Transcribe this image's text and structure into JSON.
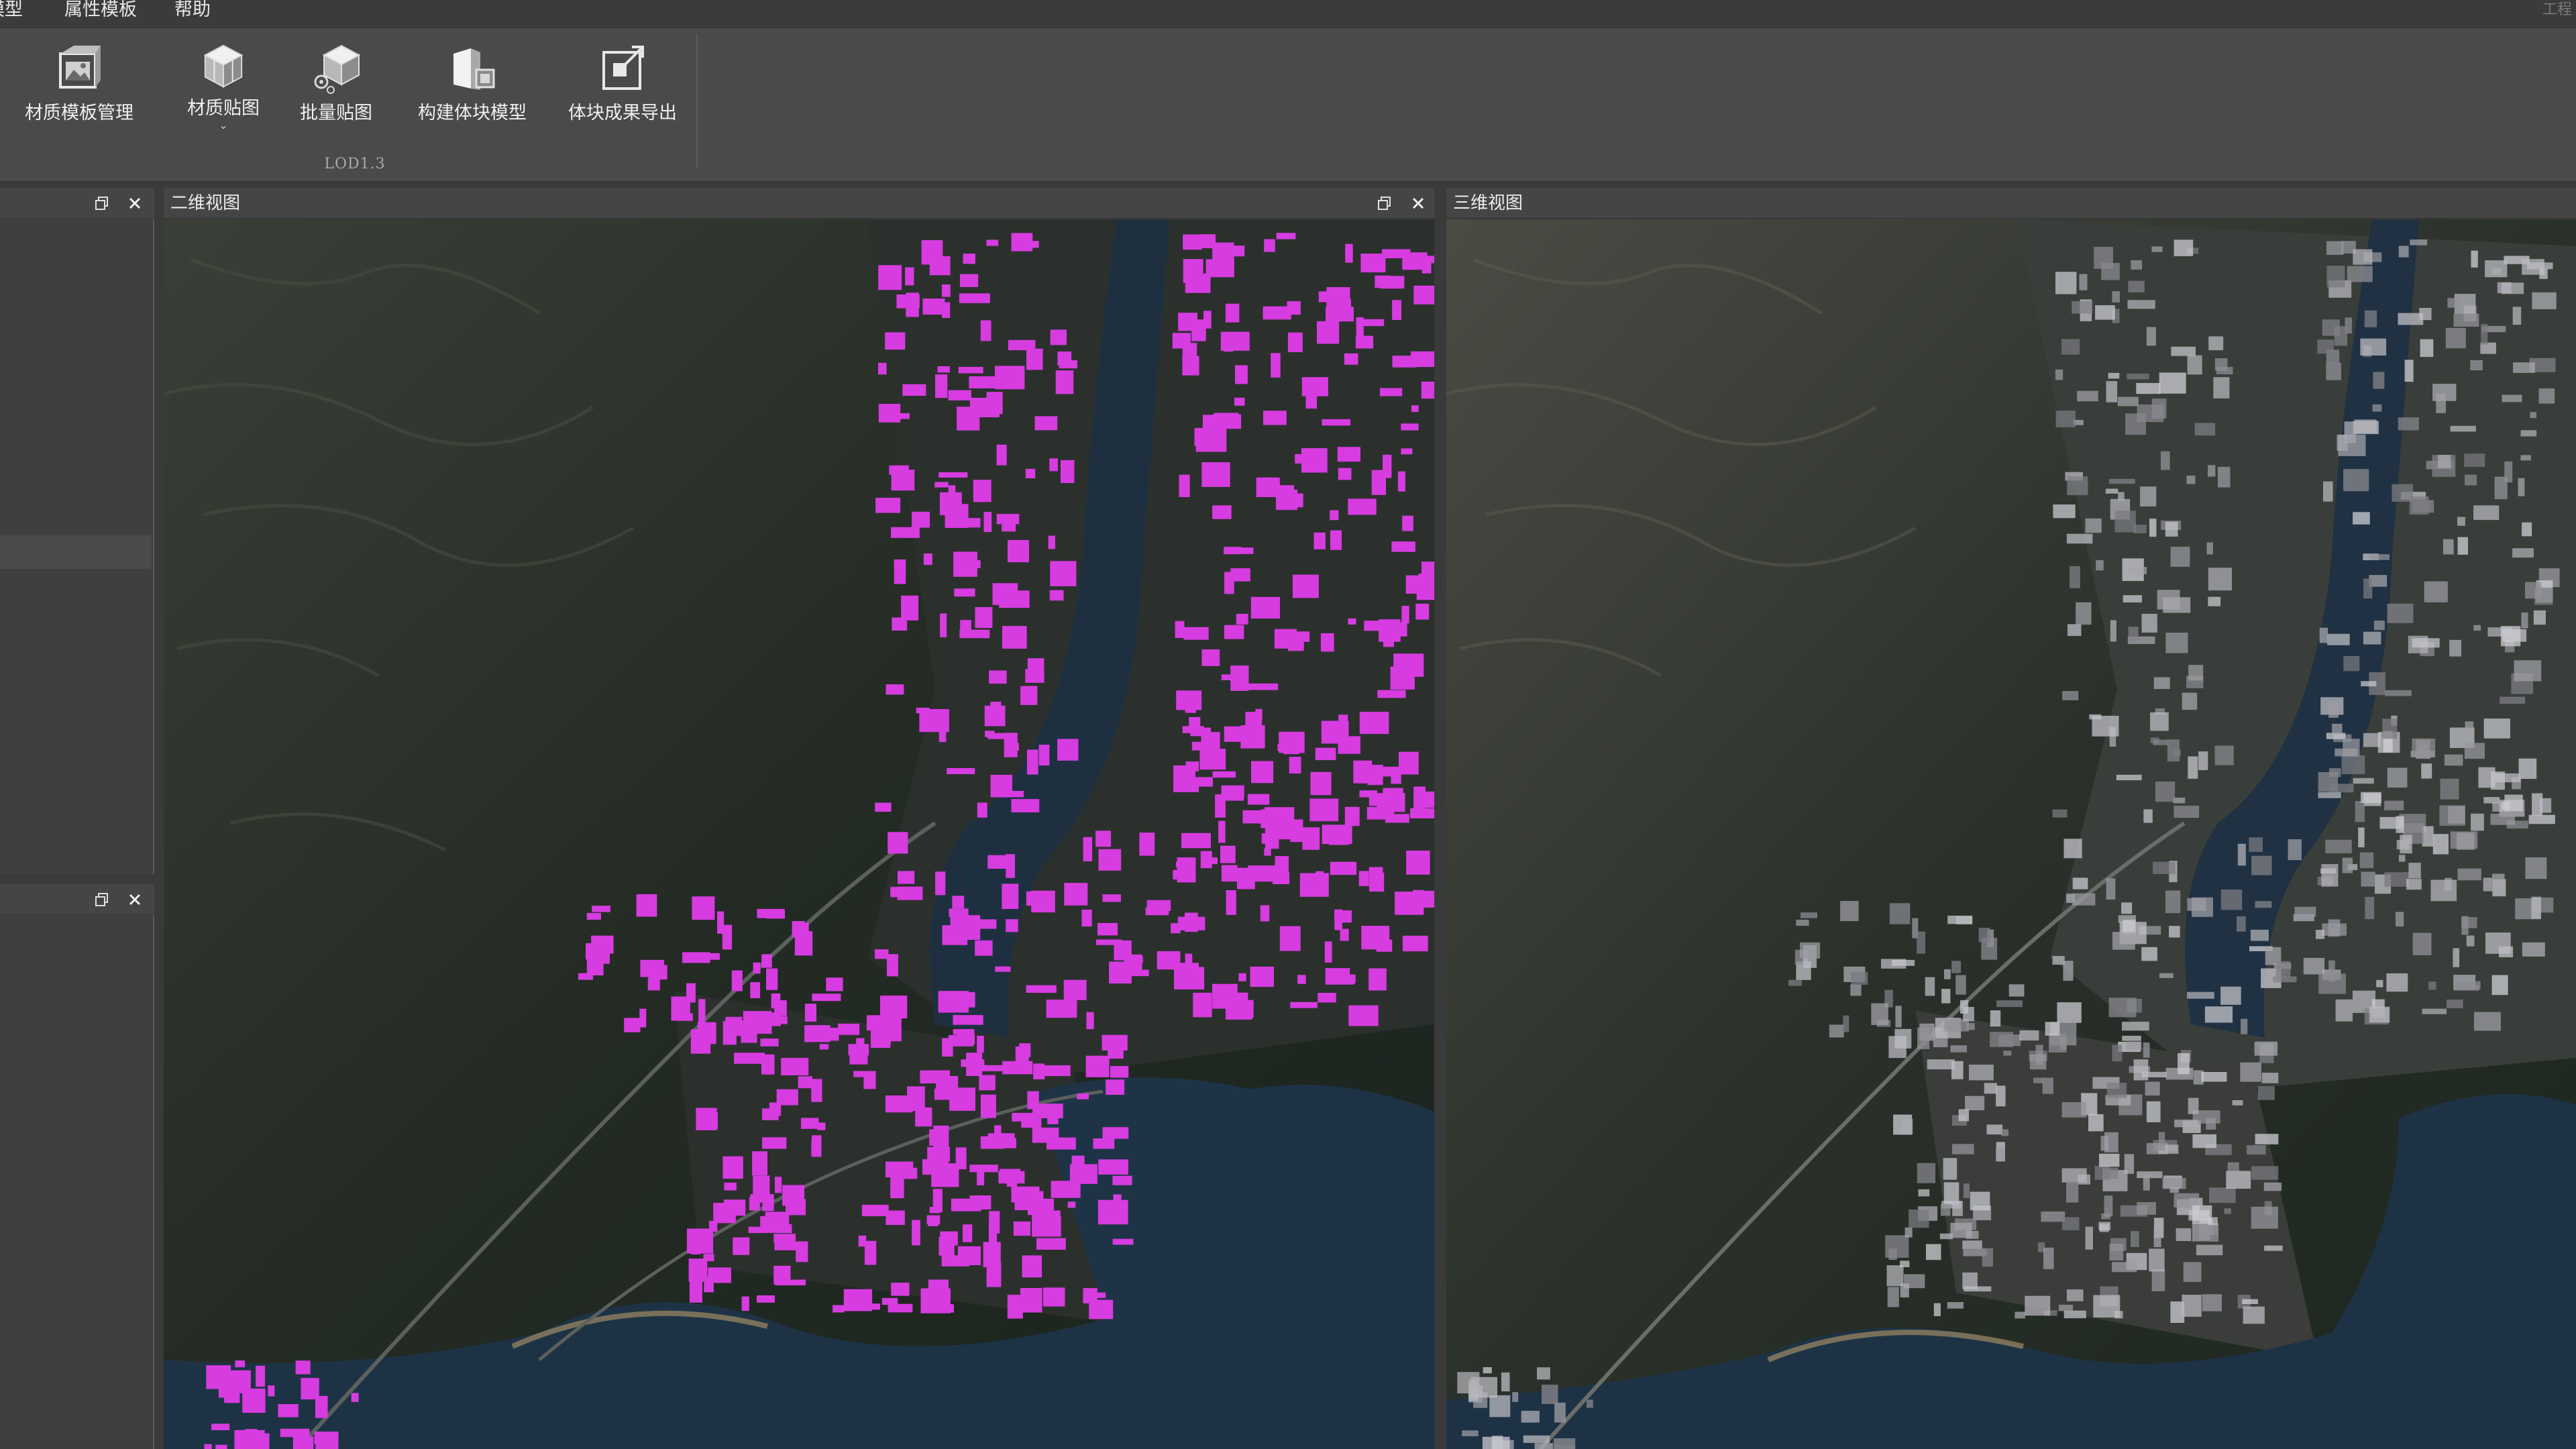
{
  "menu": {
    "items": [
      "模型",
      "属性模板",
      "帮助"
    ],
    "right_label": "工程"
  },
  "ribbon": {
    "buttons": [
      {
        "label": "材质模板管理",
        "icon": "material-template-icon"
      },
      {
        "label": "材质贴图",
        "icon": "material-texture-icon",
        "has_dropdown": true
      },
      {
        "label": "批量贴图",
        "icon": "batch-texture-icon"
      },
      {
        "label": "构建体块模型",
        "icon": "build-block-model-icon"
      },
      {
        "label": "体块成果导出",
        "icon": "export-block-icon"
      }
    ],
    "group_label": "LOD1.3"
  },
  "left_dock": {
    "top_panel": {
      "title": ""
    },
    "bottom_panel": {
      "title": ""
    }
  },
  "views": {
    "left": {
      "title": "二维视图",
      "overlay_color": "#d63ce0"
    },
    "right": {
      "title": "三维视图"
    }
  },
  "colors": {
    "background": "#3a3a3a",
    "ribbon": "#4a4a4a",
    "building_highlight": "#d63ce0",
    "water": "#1d3345",
    "terrain": "#1f2a22"
  }
}
